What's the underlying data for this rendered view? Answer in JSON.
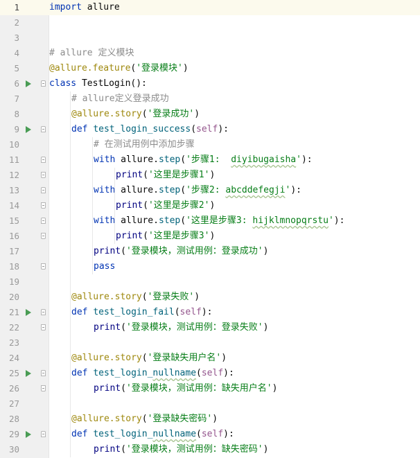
{
  "editor": {
    "current_line": 1,
    "lines": [
      {
        "n": "1",
        "indent": 0,
        "run": false,
        "fold": "",
        "tokens": [
          {
            "t": "import",
            "c": "kw"
          },
          {
            "t": " allure",
            "c": ""
          }
        ]
      },
      {
        "n": "2",
        "indent": 0,
        "run": false,
        "fold": "",
        "tokens": []
      },
      {
        "n": "3",
        "indent": 0,
        "run": false,
        "fold": "",
        "tokens": []
      },
      {
        "n": "4",
        "indent": 0,
        "run": false,
        "fold": "",
        "tokens": [
          {
            "t": "# allure 定义模块",
            "c": "cm"
          }
        ]
      },
      {
        "n": "5",
        "indent": 0,
        "run": false,
        "fold": "",
        "tokens": [
          {
            "t": "@allure.feature",
            "c": "dec"
          },
          {
            "t": "(",
            "c": "paren"
          },
          {
            "t": "'登录模块'",
            "c": "st"
          },
          {
            "t": ")",
            "c": "paren"
          }
        ]
      },
      {
        "n": "6",
        "indent": 0,
        "run": true,
        "fold": "open",
        "tokens": [
          {
            "t": "class",
            "c": "kw"
          },
          {
            "t": " TestLogin():",
            "c": ""
          }
        ]
      },
      {
        "n": "7",
        "indent": 1,
        "run": false,
        "fold": "",
        "tokens": [
          {
            "t": "# allure定义登录成功",
            "c": "cm"
          }
        ]
      },
      {
        "n": "8",
        "indent": 1,
        "run": false,
        "fold": "",
        "tokens": [
          {
            "t": "@allure.story",
            "c": "dec"
          },
          {
            "t": "(",
            "c": "paren"
          },
          {
            "t": "'登录成功'",
            "c": "st"
          },
          {
            "t": ")",
            "c": "paren"
          }
        ]
      },
      {
        "n": "9",
        "indent": 1,
        "run": true,
        "fold": "open",
        "tokens": [
          {
            "t": "def",
            "c": "kw"
          },
          {
            "t": " ",
            "c": ""
          },
          {
            "t": "test_login_success",
            "c": "fn"
          },
          {
            "t": "(",
            "c": "paren"
          },
          {
            "t": "self",
            "c": "self"
          },
          {
            "t": "):",
            "c": "paren"
          }
        ]
      },
      {
        "n": "10",
        "indent": 2,
        "run": false,
        "fold": "",
        "tokens": [
          {
            "t": "# 在测试用例中添加步骤",
            "c": "cm"
          }
        ]
      },
      {
        "n": "11",
        "indent": 2,
        "run": false,
        "fold": "open",
        "tokens": [
          {
            "t": "with",
            "c": "kw"
          },
          {
            "t": " allure.",
            "c": ""
          },
          {
            "t": "step",
            "c": "fn"
          },
          {
            "t": "(",
            "c": "paren"
          },
          {
            "t": "'步骤1:  ",
            "c": "st"
          },
          {
            "t": "diyibugaisha",
            "c": "st typo"
          },
          {
            "t": "'",
            "c": "st"
          },
          {
            "t": "):",
            "c": "paren"
          }
        ]
      },
      {
        "n": "12",
        "indent": 3,
        "run": false,
        "fold": "close",
        "tokens": [
          {
            "t": "print",
            "c": "bi"
          },
          {
            "t": "(",
            "c": "paren"
          },
          {
            "t": "'这里是步骤1'",
            "c": "st"
          },
          {
            "t": ")",
            "c": "paren"
          }
        ]
      },
      {
        "n": "13",
        "indent": 2,
        "run": false,
        "fold": "open",
        "tokens": [
          {
            "t": "with",
            "c": "kw"
          },
          {
            "t": " allure.",
            "c": ""
          },
          {
            "t": "step",
            "c": "fn"
          },
          {
            "t": "(",
            "c": "paren"
          },
          {
            "t": "'步骤2: ",
            "c": "st"
          },
          {
            "t": "abcddefegji",
            "c": "st typo"
          },
          {
            "t": "'",
            "c": "st"
          },
          {
            "t": "):",
            "c": "paren"
          }
        ]
      },
      {
        "n": "14",
        "indent": 3,
        "run": false,
        "fold": "close",
        "tokens": [
          {
            "t": "print",
            "c": "bi"
          },
          {
            "t": "(",
            "c": "paren"
          },
          {
            "t": "'这里是步骤2'",
            "c": "st"
          },
          {
            "t": ")",
            "c": "paren"
          }
        ]
      },
      {
        "n": "15",
        "indent": 2,
        "run": false,
        "fold": "open",
        "tokens": [
          {
            "t": "with",
            "c": "kw"
          },
          {
            "t": " allure.",
            "c": ""
          },
          {
            "t": "step",
            "c": "fn"
          },
          {
            "t": "(",
            "c": "paren"
          },
          {
            "t": "'这里是步骤3: ",
            "c": "st"
          },
          {
            "t": "hijklmnopqrstu",
            "c": "st typo"
          },
          {
            "t": "'",
            "c": "st"
          },
          {
            "t": "):",
            "c": "paren"
          }
        ]
      },
      {
        "n": "16",
        "indent": 3,
        "run": false,
        "fold": "close",
        "tokens": [
          {
            "t": "print",
            "c": "bi"
          },
          {
            "t": "(",
            "c": "paren"
          },
          {
            "t": "'这里是步骤3'",
            "c": "st"
          },
          {
            "t": ")",
            "c": "paren"
          }
        ]
      },
      {
        "n": "17",
        "indent": 2,
        "run": false,
        "fold": "",
        "tokens": [
          {
            "t": "print",
            "c": "bi"
          },
          {
            "t": "(",
            "c": "paren"
          },
          {
            "t": "'登录模块，测试用例：登录成功'",
            "c": "st"
          },
          {
            "t": ")",
            "c": "paren"
          }
        ]
      },
      {
        "n": "18",
        "indent": 2,
        "run": false,
        "fold": "close",
        "tokens": [
          {
            "t": "pass",
            "c": "kw"
          }
        ]
      },
      {
        "n": "19",
        "indent": 0,
        "run": false,
        "fold": "",
        "tokens": []
      },
      {
        "n": "20",
        "indent": 1,
        "run": false,
        "fold": "",
        "tokens": [
          {
            "t": "@allure.story",
            "c": "dec"
          },
          {
            "t": "(",
            "c": "paren"
          },
          {
            "t": "'登录失败'",
            "c": "st"
          },
          {
            "t": ")",
            "c": "paren"
          }
        ]
      },
      {
        "n": "21",
        "indent": 1,
        "run": true,
        "fold": "open",
        "tokens": [
          {
            "t": "def",
            "c": "kw"
          },
          {
            "t": " ",
            "c": ""
          },
          {
            "t": "test_login_fail",
            "c": "fn"
          },
          {
            "t": "(",
            "c": "paren"
          },
          {
            "t": "self",
            "c": "self"
          },
          {
            "t": "):",
            "c": "paren"
          }
        ]
      },
      {
        "n": "22",
        "indent": 2,
        "run": false,
        "fold": "close",
        "tokens": [
          {
            "t": "print",
            "c": "bi"
          },
          {
            "t": "(",
            "c": "paren"
          },
          {
            "t": "'登录模块，测试用例：登录失败'",
            "c": "st"
          },
          {
            "t": ")",
            "c": "paren"
          }
        ]
      },
      {
        "n": "23",
        "indent": 0,
        "run": false,
        "fold": "",
        "tokens": []
      },
      {
        "n": "24",
        "indent": 1,
        "run": false,
        "fold": "",
        "tokens": [
          {
            "t": "@allure.story",
            "c": "dec"
          },
          {
            "t": "(",
            "c": "paren"
          },
          {
            "t": "'登录缺失用户名'",
            "c": "st"
          },
          {
            "t": ")",
            "c": "paren"
          }
        ]
      },
      {
        "n": "25",
        "indent": 1,
        "run": true,
        "fold": "open",
        "tokens": [
          {
            "t": "def",
            "c": "kw"
          },
          {
            "t": " ",
            "c": ""
          },
          {
            "t": "test_login_",
            "c": "fn"
          },
          {
            "t": "nullname",
            "c": "fn typo"
          },
          {
            "t": "(",
            "c": "paren"
          },
          {
            "t": "self",
            "c": "self"
          },
          {
            "t": "):",
            "c": "paren"
          }
        ]
      },
      {
        "n": "26",
        "indent": 2,
        "run": false,
        "fold": "close",
        "tokens": [
          {
            "t": "print",
            "c": "bi"
          },
          {
            "t": "(",
            "c": "paren"
          },
          {
            "t": "'登录模块，测试用例：缺失用户名'",
            "c": "st"
          },
          {
            "t": ")",
            "c": "paren"
          }
        ]
      },
      {
        "n": "27",
        "indent": 0,
        "run": false,
        "fold": "",
        "tokens": []
      },
      {
        "n": "28",
        "indent": 1,
        "run": false,
        "fold": "",
        "tokens": [
          {
            "t": "@allure.story",
            "c": "dec"
          },
          {
            "t": "(",
            "c": "paren"
          },
          {
            "t": "'登录缺失密码'",
            "c": "st"
          },
          {
            "t": ")",
            "c": "paren"
          }
        ]
      },
      {
        "n": "29",
        "indent": 1,
        "run": true,
        "fold": "open",
        "tokens": [
          {
            "t": "def",
            "c": "kw"
          },
          {
            "t": " ",
            "c": ""
          },
          {
            "t": "test_login_",
            "c": "fn"
          },
          {
            "t": "nullname",
            "c": "fn typo"
          },
          {
            "t": "(",
            "c": "paren"
          },
          {
            "t": "self",
            "c": "self"
          },
          {
            "t": "):",
            "c": "paren"
          }
        ]
      },
      {
        "n": "30",
        "indent": 2,
        "run": false,
        "fold": "",
        "tokens": [
          {
            "t": "print",
            "c": "bi"
          },
          {
            "t": "(",
            "c": "paren"
          },
          {
            "t": "'登录模块，测试用例：缺失密码'",
            "c": "st"
          },
          {
            "t": ")",
            "c": "paren"
          }
        ]
      }
    ]
  }
}
